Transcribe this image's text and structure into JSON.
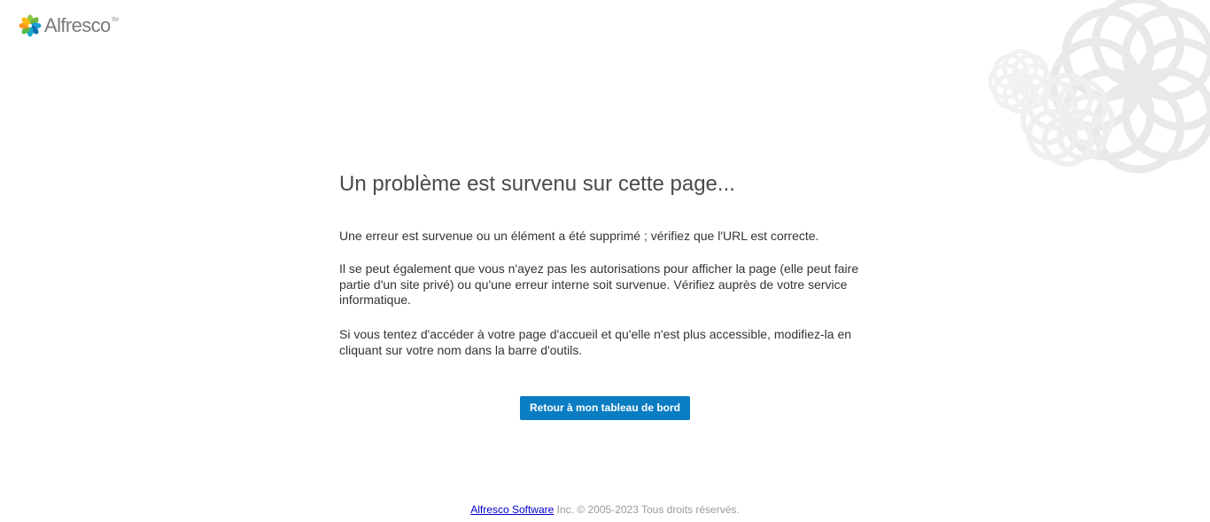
{
  "brand": {
    "name": "Alfresco",
    "tm": "TM"
  },
  "error": {
    "title": "Un problème est survenu sur cette page...",
    "paragraphs": [
      "Une erreur est survenue ou un élément a été supprimé ; vérifiez que l'URL est correcte.",
      "Il se peut également que vous n'ayez pas les autorisations pour afficher la page (elle peut faire partie d'un site privé) ou qu'une erreur interne soit survenue. Vérifiez auprès de votre service informatique.",
      "Si vous tentez d'accéder à votre page d'accueil et qu'elle n'est plus accessible, modifiez-la en cliquant sur votre nom dans la barre d'outils."
    ],
    "button_label": "Retour à mon tableau de bord"
  },
  "footer": {
    "link_text": "Alfresco Software",
    "text": " Inc. © 2005-2023 Tous droits réservés."
  },
  "colors": {
    "button": "#0a7cc2",
    "title": "#4a4a4a",
    "footer_text": "#9a9a9a",
    "link": "#0000cc"
  },
  "icons": {
    "logo": "alfresco-flower-logo-icon",
    "decoration": "flower-decoration-icon"
  }
}
